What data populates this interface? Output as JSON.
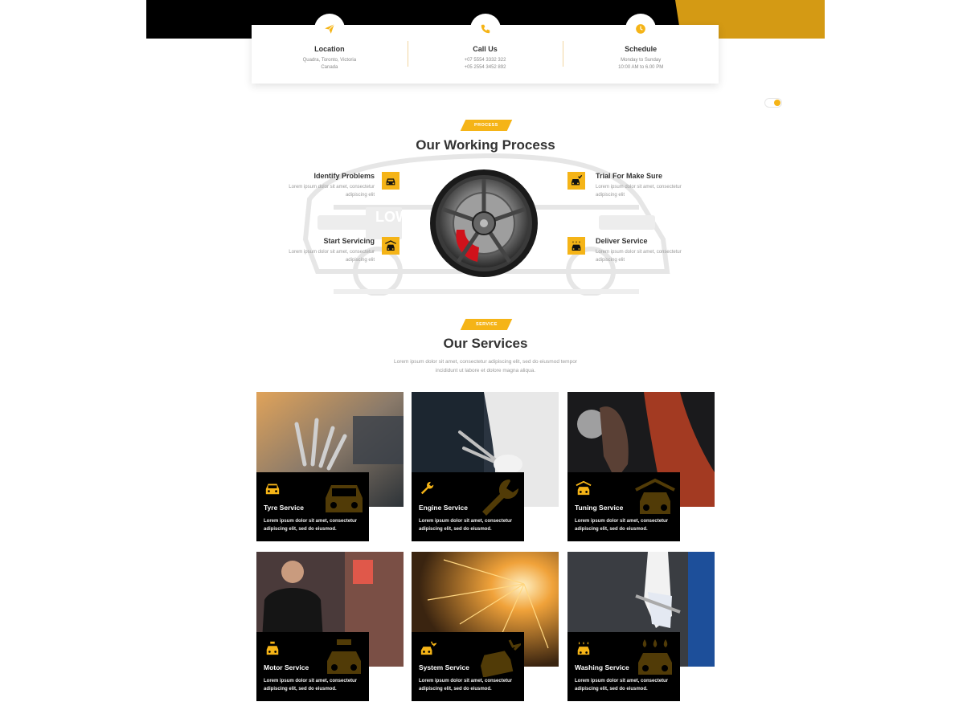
{
  "contact": [
    {
      "icon": "paper-plane-icon",
      "title": "Location",
      "lines": [
        "Quadra, Toronto, Victoria",
        "Canada"
      ]
    },
    {
      "icon": "phone-icon",
      "title": "Call Us",
      "lines": [
        "+07 5554 3332 322",
        "+05 2554 3452 892"
      ]
    },
    {
      "icon": "clock-icon",
      "title": "Schedule",
      "lines": [
        "Monday to Sunday",
        "10:00 AM to 6.00 PM"
      ]
    }
  ],
  "process": {
    "badge": "PROCESS",
    "title": "Our Working Process",
    "steps": [
      {
        "title": "Identify Problems",
        "text1": "Lorem ipsum dolor sit amet, consectetur",
        "text2": "adipiscing elit",
        "icon": "car-front-icon"
      },
      {
        "title": "Trial For Make Sure",
        "text1": "Lorem ipsum dolor sit amet, consectetur",
        "text2": "adipiscing elit",
        "icon": "car-check-icon"
      },
      {
        "title": "Start Servicing",
        "text1": "Lorem ipsum dolor sit amet, consectetur",
        "text2": "adipiscing elit",
        "icon": "car-garage-icon"
      },
      {
        "title": "Deliver Service",
        "text1": "Lorem ipsum dolor sit amet, consectetur",
        "text2": "adipiscing elit",
        "icon": "car-wash-icon"
      }
    ]
  },
  "services": {
    "badge": "SERVICE",
    "title": "Our Services",
    "subtitle1": "Lorem ipsum dolor sit amet, consectetur adipiscing elit, sed do eiusmod tempor",
    "subtitle2": "incididunt ut labore et dolore magna aliqua.",
    "cards": [
      {
        "name": "Tyre Service",
        "desc": "Lorem ipsum dolor sit amet, consectetur adipiscing elit, sed do eiusmod.",
        "icon": "car-icon"
      },
      {
        "name": "Engine Service",
        "desc": "Lorem ipsum dolor sit amet, consectetur adipiscing elit, sed do eiusmod.",
        "icon": "wrench-icon"
      },
      {
        "name": "Tuning Service",
        "desc": "Lorem ipsum dolor sit amet, consectetur adipiscing elit, sed do eiusmod.",
        "icon": "car-garage-icon"
      },
      {
        "name": "Motor Service",
        "desc": "Lorem ipsum dolor sit amet, consectetur adipiscing elit, sed do eiusmod.",
        "icon": "car-repair-icon"
      },
      {
        "name": "System Service",
        "desc": "Lorem ipsum dolor sit amet, consectetur adipiscing elit, sed do eiusmod.",
        "icon": "car-crash-icon"
      },
      {
        "name": "Washing Service",
        "desc": "Lorem ipsum dolor sit amet, consectetur adipiscing elit, sed do eiusmod.",
        "icon": "car-wash-icon"
      }
    ]
  },
  "colors": {
    "accent": "#f5b417",
    "banner_accent": "#d49a14",
    "dark": "#000000"
  }
}
